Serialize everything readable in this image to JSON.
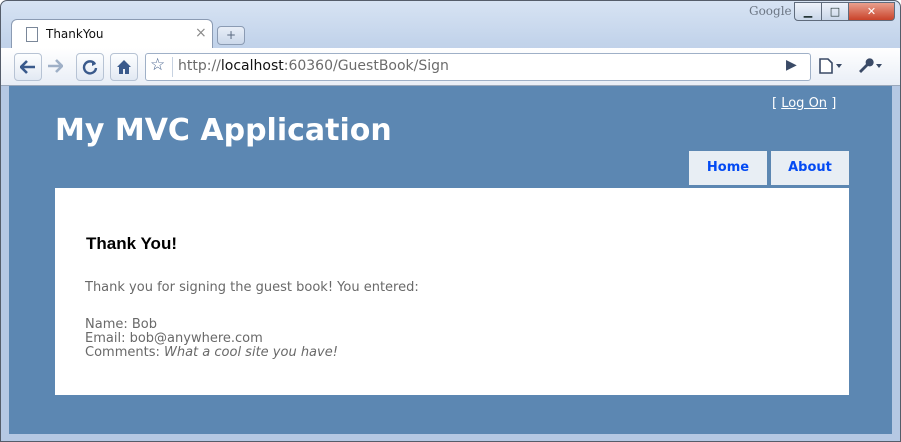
{
  "browser": {
    "brand": "Google",
    "tab_title": "ThankYou",
    "tab_close": "×",
    "new_tab": "+",
    "url_scheme": "http://",
    "url_host": "localhost",
    "url_rest": ":60360/GuestBook/Sign",
    "window_buttons": {
      "minimize": "▁",
      "maximize": "□",
      "close": "✕"
    },
    "icons": [
      "back-icon",
      "forward-icon",
      "reload-icon",
      "home-icon",
      "bookmark-star-icon",
      "go-icon",
      "page-menu-icon",
      "wrench-menu-icon"
    ]
  },
  "page": {
    "login_open": "[",
    "login_link": "Log On",
    "login_close": "]",
    "site_title": "My MVC Application",
    "menu": {
      "home": "Home",
      "about": "About"
    },
    "heading": "Thank You!",
    "intro": "Thank you for signing the guest book! You entered:",
    "name_label": "Name:",
    "name_value": "Bob",
    "email_label": "Email:",
    "email_value": "bob@anywhere.com",
    "comments_label": "Comments:",
    "comments_value": "What a cool site you have!"
  },
  "colors": {
    "page_background": "#5c87b2",
    "menu_background": "#e8eef4",
    "menu_link": "#034af3",
    "body_text": "#696969"
  }
}
